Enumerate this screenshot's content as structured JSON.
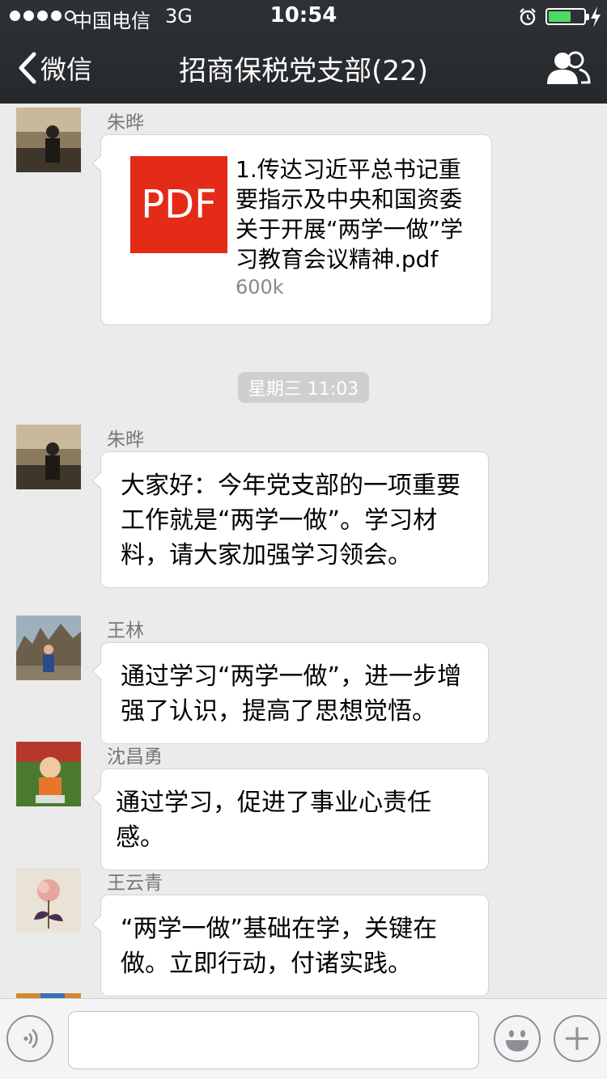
{
  "status_bar": {
    "carrier": "中国电信",
    "network": "3G",
    "time": "10:54",
    "battery_level": 0.58
  },
  "nav": {
    "back_label": "微信",
    "title": "招商保税党支部(22)"
  },
  "chat": {
    "timestamp": "星期三 11:03",
    "file_message": {
      "sender": "朱晔",
      "badge": "PDF",
      "file_name": "1.传达习近平总书记重要指示及中央和国资委关于开展“两学一做”学习教育会议精神.pdf",
      "file_size": "600k"
    },
    "messages": [
      {
        "sender": "朱晔",
        "text": "大家好：今年党支部的一项重要工作就是“两学一做”。学习材料，请大家加强学习领会。"
      },
      {
        "sender": "王林",
        "text": "通过学习“两学一做”，进一步增强了认识，提高了思想觉悟。"
      },
      {
        "sender": "沈昌勇",
        "text": "通过学习，促进了事业心责任感。"
      },
      {
        "sender": "王云青",
        "text": "“两学一做”基础在学，关键在做。立即行动，付诸实践。"
      }
    ]
  },
  "colors": {
    "nav_bg": "#2e3135",
    "chat_bg": "#ebebeb",
    "pdf_red": "#e32b18",
    "battery_green": "#4cd964"
  },
  "icons": {
    "back": "chevron-left-icon",
    "group": "group-members-icon",
    "voice": "voice-icon",
    "emoji": "smiley-icon",
    "plus": "plus-icon"
  }
}
